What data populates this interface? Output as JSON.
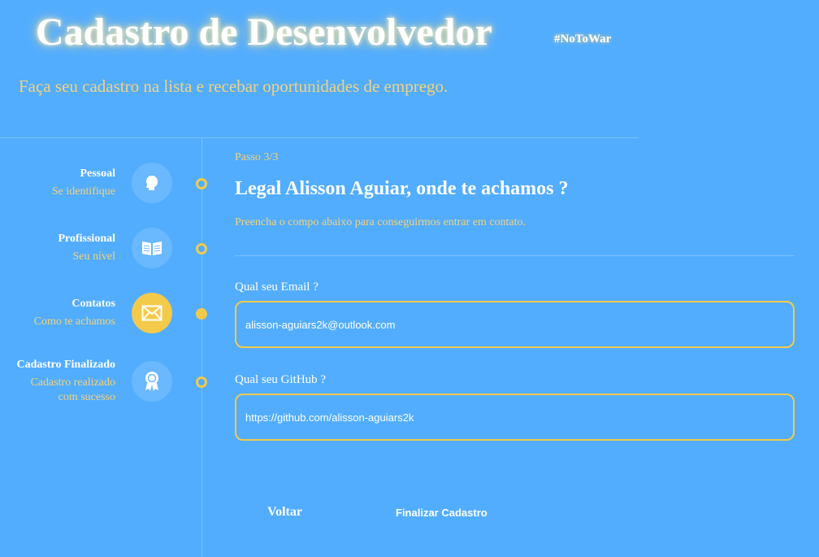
{
  "header": {
    "title": "Cadastro de Desenvolvedor",
    "tag": "#NoToWar",
    "subtitle": "Faça seu cadastro na lista e recebar oportunidades de emprego."
  },
  "steps": [
    {
      "name": "Pessoal",
      "desc": "Se identifique",
      "icon": "person-head-icon",
      "state": "done"
    },
    {
      "name": "Profissional",
      "desc": "Seu nível",
      "icon": "open-book-icon",
      "state": "done"
    },
    {
      "name": "Contatos",
      "desc": "Como te achamos",
      "icon": "envelope-icon",
      "state": "active"
    },
    {
      "name": "Cadastro Finalizado",
      "desc_line1": "Cadastro realizado",
      "desc_line2": "com sucesso",
      "icon": "award-badge-icon",
      "state": "pending"
    }
  ],
  "form": {
    "step": "Passo 3/3",
    "heading": "Legal Alisson Aguiar, onde te achamos ?",
    "lead": "Preencha o compo abaixo para conseguirmos entrar em contato.",
    "email": {
      "label": "Qual seu Email ?",
      "value": "alisson-aguiars2k@outlook.com"
    },
    "github": {
      "label": "Qual seu GitHub ?",
      "value": "https://github.com/alisson-aguiars2k"
    },
    "back_label": "Voltar",
    "finish_label": "Finalizar Cadastro"
  },
  "colors": {
    "background": "#52adfe",
    "accent": "#f3ca4a",
    "muted_text": "#f3d27a",
    "icon_circle": "#6ab8fd"
  }
}
